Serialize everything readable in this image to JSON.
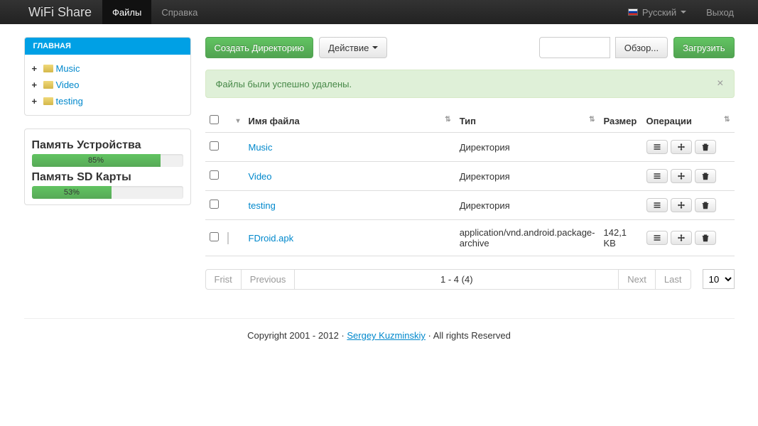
{
  "navbar": {
    "brand": "WiFi Share",
    "files": "Файлы",
    "help": "Справка",
    "language": "Русский",
    "logout": "Выход"
  },
  "sidebar": {
    "header": "ГЛАВНАЯ",
    "items": [
      {
        "label": "Music"
      },
      {
        "label": "Video"
      },
      {
        "label": "testing"
      }
    ]
  },
  "memory": {
    "device_label": "Память Устройства",
    "device_pct": "85%",
    "device_pct_val": 85,
    "sd_label": "Память SD Карты",
    "sd_pct": "53%",
    "sd_pct_val": 53
  },
  "toolbar": {
    "create_dir": "Создать Директорию",
    "action": "Действие",
    "browse": "Обзор...",
    "upload": "Загрузить"
  },
  "alert": {
    "message": "Файлы были успешно удалены."
  },
  "table": {
    "headers": {
      "name": "Имя файла",
      "type": "Тип",
      "size": "Размер",
      "ops": "Операции"
    },
    "rows": [
      {
        "name": "Music",
        "type": "Директория",
        "size": "",
        "is_dir": true
      },
      {
        "name": "Video",
        "type": "Директория",
        "size": "",
        "is_dir": true
      },
      {
        "name": "testing",
        "type": "Директория",
        "size": "",
        "is_dir": true
      },
      {
        "name": "FDroid.apk",
        "type": "application/vnd.android.package-archive",
        "size": "142,1 KB",
        "is_dir": false
      }
    ]
  },
  "pager": {
    "first": "Frist",
    "previous": "Previous",
    "info": "1 - 4 (4)",
    "next": "Next",
    "last": "Last",
    "page_size": "10"
  },
  "footer": {
    "prefix": "Copyright 2001 - 2012 · ",
    "author": "Sergey Kuzminskiy",
    "suffix": " · All rights Reserved"
  }
}
